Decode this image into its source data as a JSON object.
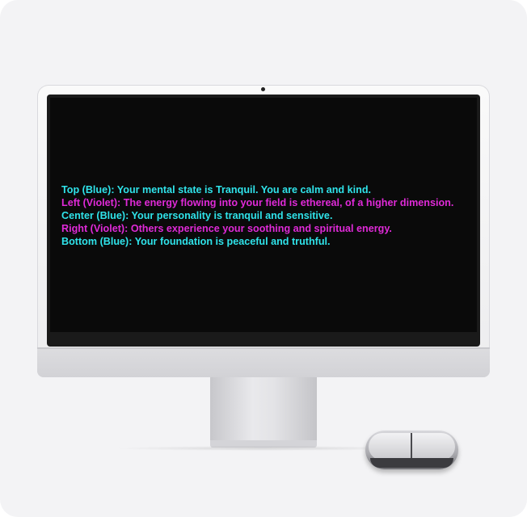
{
  "screen": {
    "lines": [
      {
        "text": "Top (Blue): Your mental state is Tranquil. You are calm and kind.",
        "color": "#2fe3ea"
      },
      {
        "text": "Left (Violet): The energy flowing into your field is ethereal, of a higher dimension.",
        "color": "#e02ad8"
      },
      {
        "text": "Center (Blue): Your personality is tranquil and sensitive.",
        "color": "#2fe3ea"
      },
      {
        "text": "Right (Violet): Others experience your soothing and spiritual energy.",
        "color": "#e02ad8"
      },
      {
        "text": "Bottom (Blue): Your foundation is peaceful and truthful.",
        "color": "#2fe3ea"
      }
    ]
  }
}
